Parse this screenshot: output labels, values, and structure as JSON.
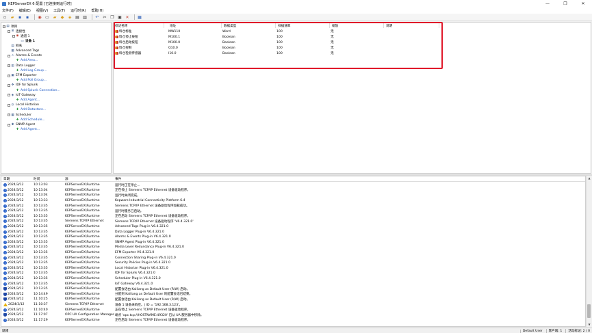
{
  "window": {
    "title": "KEPServerEX 6 配置 [已连接到运行时]",
    "minimize": "—",
    "maximize": "❐",
    "close": "✕"
  },
  "menu": [
    "文件(F)",
    "编辑(E)",
    "视图(V)",
    "工具(T)",
    "运行时(R)",
    "帮助(H)"
  ],
  "toolbar": [
    "new-icon",
    "open-icon",
    "save-icon",
    "save-as-icon",
    "new-channel-icon",
    "new-device-icon",
    "new-group-icon",
    "new-tag-icon",
    "bulk-tag-icon",
    "import-icon",
    "export-icon",
    "undo-icon",
    "cut-icon",
    "copy-icon",
    "paste-icon",
    "delete-icon",
    "properties-icon",
    "quick-client-icon"
  ],
  "tree": [
    {
      "label": "项目",
      "level": 0,
      "icon": "project-icon",
      "link": false,
      "exp": "−"
    },
    {
      "label": "连接性",
      "level": 1,
      "icon": "connectivity-icon",
      "link": false,
      "exp": "−"
    },
    {
      "label": "通道 1",
      "level": 2,
      "icon": "channel-icon",
      "link": false,
      "exp": "−"
    },
    {
      "label": "设备 1",
      "level": 3,
      "icon": "device-icon",
      "link": false,
      "exp": "",
      "bold": true
    },
    {
      "label": "别名",
      "level": 1,
      "icon": "alias-icon",
      "link": false,
      "exp": ""
    },
    {
      "label": "Advanced Tags",
      "level": 1,
      "icon": "advanced-tags-icon",
      "link": false,
      "exp": ""
    },
    {
      "label": "Alarms & Events",
      "level": 1,
      "icon": "alarms-icon",
      "link": false,
      "exp": "−"
    },
    {
      "label": "Add Area...",
      "level": 2,
      "icon": "add-icon",
      "link": true,
      "exp": ""
    },
    {
      "label": "Data Logger",
      "level": 1,
      "icon": "data-logger-icon",
      "link": false,
      "exp": "−"
    },
    {
      "label": "Add Log Group...",
      "level": 2,
      "icon": "add-icon",
      "link": true,
      "exp": ""
    },
    {
      "label": "EFM Exporter",
      "level": 1,
      "icon": "efm-icon",
      "link": false,
      "exp": "−"
    },
    {
      "label": "Add Poll Group...",
      "level": 2,
      "icon": "add-icon",
      "link": true,
      "exp": ""
    },
    {
      "label": "IDF for Splunk",
      "level": 1,
      "icon": "splunk-icon",
      "link": false,
      "exp": "−"
    },
    {
      "label": "Add Splunk Connection...",
      "level": 2,
      "icon": "add-icon",
      "link": true,
      "exp": ""
    },
    {
      "label": "IoT Gateway",
      "level": 1,
      "icon": "iot-gateway-icon",
      "link": false,
      "exp": "−"
    },
    {
      "label": "Add Agent...",
      "level": 2,
      "icon": "add-icon",
      "link": true,
      "exp": ""
    },
    {
      "label": "Local Historian",
      "level": 1,
      "icon": "historian-icon",
      "link": false,
      "exp": "−"
    },
    {
      "label": "Add Datastore...",
      "level": 2,
      "icon": "add-icon",
      "link": true,
      "exp": ""
    },
    {
      "label": "Scheduler",
      "level": 1,
      "icon": "scheduler-icon",
      "link": false,
      "exp": "−"
    },
    {
      "label": "Add Schedule...",
      "level": 2,
      "icon": "add-icon",
      "link": true,
      "exp": ""
    },
    {
      "label": "SNMP Agent",
      "level": 1,
      "icon": "snmp-icon",
      "link": false,
      "exp": "−"
    },
    {
      "label": "Add Agent...",
      "level": 2,
      "icon": "add-icon",
      "link": true,
      "exp": ""
    }
  ],
  "tags": {
    "headers": [
      "标记名称",
      "地址",
      "数据类型",
      "扫描速率",
      "缩放",
      "说明"
    ],
    "rows": [
      [
        "料仓标准",
        "MW110",
        "Word",
        "100",
        "无",
        ""
      ],
      [
        "料仓停止按钮",
        "M100.1",
        "Boolean",
        "100",
        "无",
        ""
      ],
      [
        "料仓启动按钮",
        "M100.0",
        "Boolean",
        "100",
        "无",
        ""
      ],
      [
        "料仓控制",
        "Q10.0",
        "Boolean",
        "100",
        "无",
        ""
      ],
      [
        "料仓检测传感器",
        "I10.0",
        "Boolean",
        "100",
        "无",
        ""
      ]
    ]
  },
  "log": {
    "headers": [
      "日期",
      "时间",
      "源",
      "事件"
    ],
    "rows": [
      {
        "icon": "info",
        "date": "2024/3/12",
        "time": "10:13:03",
        "source": "KEPServerEX\\Runtime",
        "event": "运行时正在停止..."
      },
      {
        "icon": "info",
        "date": "2024/3/12",
        "time": "10:13:04",
        "source": "KEPServerEX\\Runtime",
        "event": "正在停止 Siemens TCP/IP Ethernet 设备驱动程序。"
      },
      {
        "icon": "info",
        "date": "2024/3/12",
        "time": "10:13:04",
        "source": "KEPServerEX\\Runtime",
        "event": "运行时关闭完成。"
      },
      {
        "icon": "info",
        "date": "2024/3/12",
        "time": "10:13:33",
        "source": "KEPServerEX\\Runtime",
        "event": "Kepware Industrial Connectivity Platform 6.4"
      },
      {
        "icon": "info",
        "date": "2024/3/12",
        "time": "10:13:35",
        "source": "KEPServerEX\\Runtime",
        "event": "Siemens TCP/IP Ethernet 设备驱动程序加载成功。"
      },
      {
        "icon": "info",
        "date": "2024/3/12",
        "time": "10:13:35",
        "source": "KEPServerEX\\Runtime",
        "event": "运行时服务已启动。"
      },
      {
        "icon": "info",
        "date": "2024/3/12",
        "time": "10:13:35",
        "source": "KEPServerEX\\Runtime",
        "event": "正在启动 Siemens TCP/IP Ethernet 设备驱动程序。"
      },
      {
        "icon": "info",
        "date": "2024/3/12",
        "time": "10:13:35",
        "source": "Siemens TCP/IP Ethernet",
        "event": "Siemens TCP/IP Ethernet 设备驱动程序 'V6.4.321.0'"
      },
      {
        "icon": "info",
        "date": "2024/3/12",
        "time": "10:13:35",
        "source": "KEPServerEX\\Runtime",
        "event": "Advanced Tags Plug-in V6.4.321.0"
      },
      {
        "icon": "info",
        "date": "2024/3/12",
        "time": "10:13:35",
        "source": "KEPServerEX\\Runtime",
        "event": "Data Logger Plug-in V6.4.321.0"
      },
      {
        "icon": "info",
        "date": "2024/3/12",
        "time": "10:13:35",
        "source": "KEPServerEX\\Runtime",
        "event": "Alarms & Events Plug-in V6.4.321.0"
      },
      {
        "icon": "info",
        "date": "2024/3/12",
        "time": "10:13:35",
        "source": "KEPServerEX\\Runtime",
        "event": "SNMP Agent Plug-in V6.4.321.0"
      },
      {
        "icon": "info",
        "date": "2024/3/12",
        "time": "10:13:35",
        "source": "KEPServerEX\\Runtime",
        "event": "Media Level Redundancy Plug-in V6.4.321.0"
      },
      {
        "icon": "info",
        "date": "2024/3/12",
        "time": "10:13:35",
        "source": "KEPServerEX\\Runtime",
        "event": "EFM Exporter V6.4.321.0"
      },
      {
        "icon": "info",
        "date": "2024/3/12",
        "time": "10:13:35",
        "source": "KEPServerEX\\Runtime",
        "event": "Connection Sharing Plug-in V6.4.321.0"
      },
      {
        "icon": "info",
        "date": "2024/3/12",
        "time": "10:13:35",
        "source": "KEPServerEX\\Runtime",
        "event": "Security Policies Plug-in V6.4.321.0"
      },
      {
        "icon": "info",
        "date": "2024/3/12",
        "time": "10:13:35",
        "source": "KEPServerEX\\Runtime",
        "event": "Local Historian Plug-in V6.4.321.0"
      },
      {
        "icon": "info",
        "date": "2024/3/12",
        "time": "10:13:35",
        "source": "KEPServerEX\\Runtime",
        "event": "IDF for Splunk V6.4.321.0"
      },
      {
        "icon": "info",
        "date": "2024/3/12",
        "time": "10:13:35",
        "source": "KEPServerEX\\Runtime",
        "event": "Scheduler Plug-in V6.4.321.0"
      },
      {
        "icon": "info",
        "date": "2024/3/12",
        "time": "10:13:35",
        "source": "KEPServerEX\\Runtime",
        "event": "IoT Gateway V6.4.321.0"
      },
      {
        "icon": "shield",
        "date": "2024/3/12",
        "time": "10:13:35",
        "source": "KEPServerEX\\Runtime",
        "event": "配置会话由 Kailiang as Default User (R/W) 启动。"
      },
      {
        "icon": "shield",
        "date": "2024/3/12",
        "time": "10:14:49",
        "source": "KEPServerEX\\Runtime",
        "event": "分配到 Kailiang as Default User 的配置会话已结束。"
      },
      {
        "icon": "shield",
        "date": "2024/3/12",
        "time": "11:10:25",
        "source": "KEPServerEX\\Runtime",
        "event": "配置会话由 Kailiang as Default User (R/W) 启动。"
      },
      {
        "icon": "warn",
        "date": "2024/3/12",
        "time": "11:10:37",
        "source": "Siemens TCP/IP Ethernet",
        "event": "设备 1 设备未响应。| ID = '192.168.3.123'。"
      },
      {
        "icon": "info",
        "date": "2024/3/12",
        "time": "11:10:40",
        "source": "KEPServerEX\\Runtime",
        "event": "正在停止 Siemens TCP/IP Ethernet 设备驱动程序。"
      },
      {
        "icon": "shield",
        "date": "2024/3/12",
        "time": "11:17:07",
        "source": "OPC UA Configuration Manager",
        "event": "端点 'opc.tcp://HOSTNAME:49320' 已从 UA 服务器中移除。"
      },
      {
        "icon": "info",
        "date": "2024/3/12",
        "time": "11:17:29",
        "source": "KEPServerEX\\Runtime",
        "event": "正在启动 Siemens TCP/IP Ethernet 设备驱动程序。"
      }
    ]
  },
  "status": {
    "left": "就绪",
    "user": "Default User",
    "clients": "客户端: 1",
    "active_tags": "活动标记: 2 / 0"
  }
}
